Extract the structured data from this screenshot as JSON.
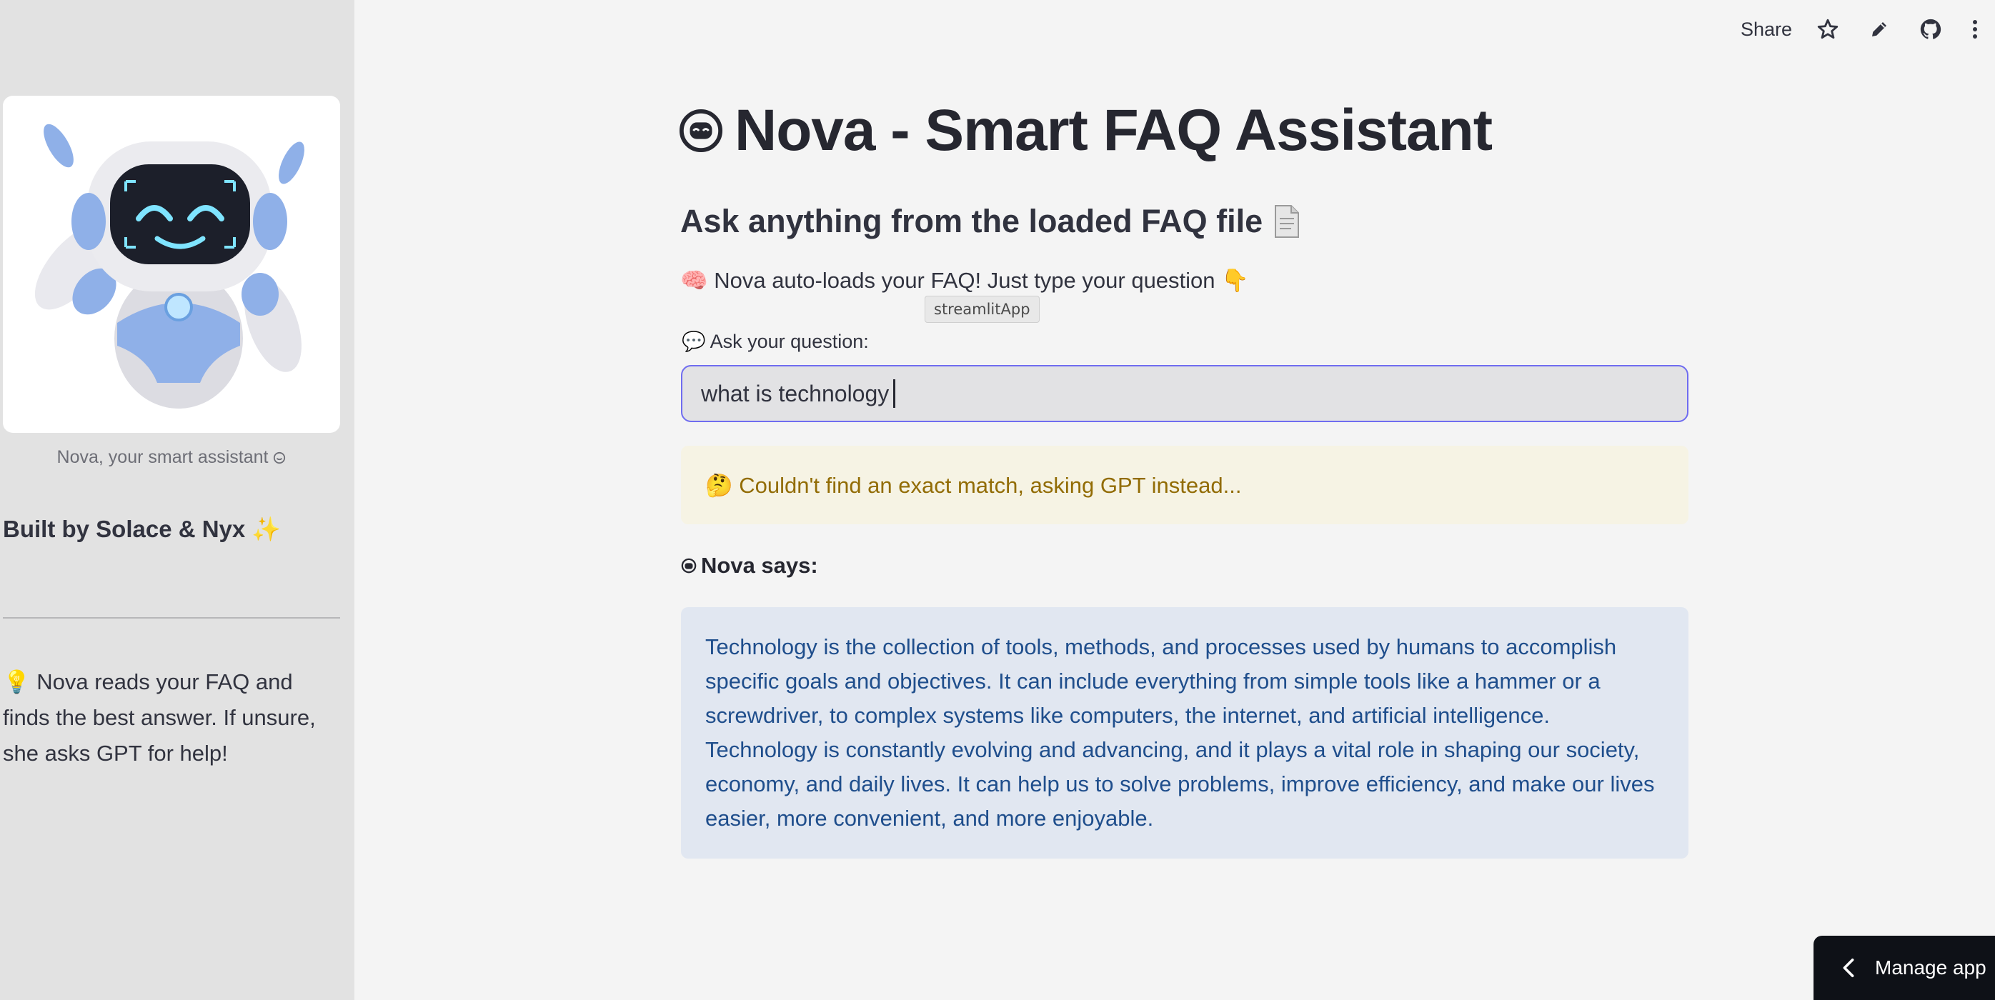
{
  "toolbar": {
    "share_label": "Share",
    "icons": [
      "star-icon",
      "pencil-icon",
      "github-icon",
      "kebab-menu-icon"
    ]
  },
  "sidebar": {
    "image_alt": "Nova robot mascot",
    "caption": "Nova, your smart assistant",
    "built_by": "Built by Solace & Nyx ✨",
    "info": "💡 Nova reads your FAQ and finds the best answer. If unsure, she asks GPT for help!"
  },
  "main": {
    "title": "Nova - Smart FAQ Assistant",
    "subtitle": "Ask anything from the loaded FAQ file",
    "intro": "🧠 Nova auto-loads your FAQ! Just type your question 👇",
    "tooltip": "streamlitApp",
    "question_label": "💬 Ask your question:",
    "question_value": "what is technology",
    "warning": "🤔 Couldn't find an exact match, asking GPT instead...",
    "nova_says": "Nova says:",
    "answer": "Technology is the collection of tools, methods, and processes used by humans to accomplish specific goals and objectives. It can include everything from simple tools like a hammer or a screwdriver, to complex systems like computers, the internet, and artificial intelligence. Technology is constantly evolving and advancing, and it plays a vital role in shaping our society, economy, and daily lives. It can help us to solve problems, improve efficiency, and make our lives easier, more convenient, and more enjoyable."
  },
  "footer": {
    "manage_app": "Manage app"
  },
  "colors": {
    "sidebar_bg": "#e2e2e2",
    "page_bg": "#f4f4f4",
    "input_focus_border": "#6f6cf0",
    "warning_bg": "#f6f3e4",
    "warning_text": "#926c05",
    "info_bg": "#e1e7f1",
    "info_text": "#1f4e8c",
    "manage_app_bg": "#0e1117"
  }
}
